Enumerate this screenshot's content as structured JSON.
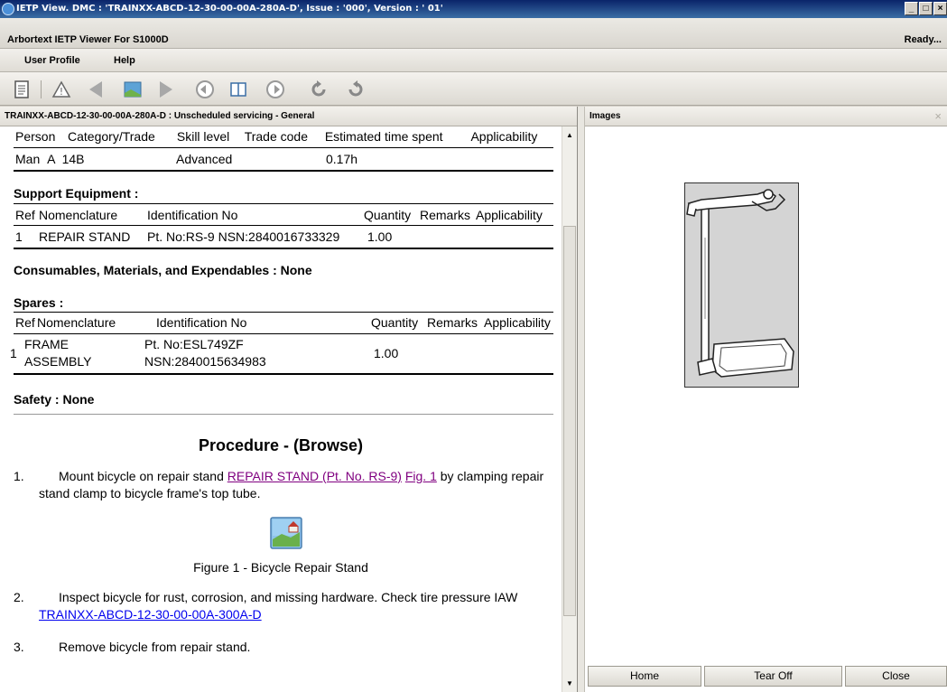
{
  "window": {
    "title": "IETP View.   DMC : 'TRAINXX-ABCD-12-30-00-00A-280A-D',   Issue : '000',   Version : ' 01'",
    "btn_min": "_",
    "btn_max": "□",
    "btn_close": "×"
  },
  "app": {
    "name": "Arbortext IETP Viewer For S1000D",
    "status": "Ready..."
  },
  "menu": {
    "items": [
      "User Profile",
      "Help"
    ]
  },
  "toolbar": {
    "icons": [
      "document-icon",
      "warning-icon",
      "back-triangle-icon",
      "image-icon",
      "forward-triangle-icon",
      "back-circle-icon",
      "book-icon",
      "forward-circle-icon",
      "history-back-icon",
      "history-forward-icon"
    ]
  },
  "left_pane": {
    "header": "TRAINXX-ABCD-12-30-00-00A-280A-D : Unscheduled servicing - General"
  },
  "personnel": {
    "headers": [
      "Person",
      "Category/Trade",
      "Skill level",
      "Trade code",
      "Estimated time spent",
      "Applicability"
    ],
    "row": [
      "Man",
      "A",
      "14B",
      "Advanced",
      "",
      "0.17h",
      ""
    ]
  },
  "support_equipment": {
    "title": "Support Equipment :",
    "headers": [
      "Ref",
      "Nomenclature",
      "Identification No",
      "Quantity",
      "Remarks",
      "Applicability"
    ],
    "row": [
      "1",
      "REPAIR STAND",
      "Pt. No:RS-9 NSN:2840016733329",
      "1.00",
      "",
      ""
    ]
  },
  "consumables": {
    "title": "Consumables, Materials, and Expendables : None"
  },
  "spares": {
    "title": "Spares :",
    "headers": [
      "Ref",
      "Nomenclature",
      "Identification No",
      "Quantity",
      "Remarks",
      "Applicability"
    ],
    "row": [
      "1",
      "FRAME",
      "ASSEMBLY",
      "Pt. No:ESL749ZF",
      "NSN:2840015634983",
      "1.00"
    ]
  },
  "safety": {
    "title": "Safety : None"
  },
  "procedure": {
    "title": "Procedure - (Browse)",
    "step1": {
      "num": "1.",
      "text_a": "Mount bicycle on repair stand ",
      "link1": "REPAIR STAND (Pt. No. RS-9)",
      "link2": "Fig. 1",
      "text_b": " by clamping repair stand clamp to bicycle frame's top tube."
    },
    "figure_caption": "Figure 1 - Bicycle Repair Stand",
    "step2": {
      "num": "2.",
      "text_a": "Inspect bicycle for rust, corrosion, and missing hardware. Check tire pressure IAW ",
      "link": "TRAINXX-ABCD-12-30-00-00A-300A-D"
    },
    "step3": {
      "num": "3.",
      "text": "Remove bicycle from repair stand."
    }
  },
  "right_pane": {
    "header": "Images",
    "close": "×"
  },
  "buttons": {
    "home": "Home",
    "tear_off": "Tear Off",
    "close": "Close"
  }
}
